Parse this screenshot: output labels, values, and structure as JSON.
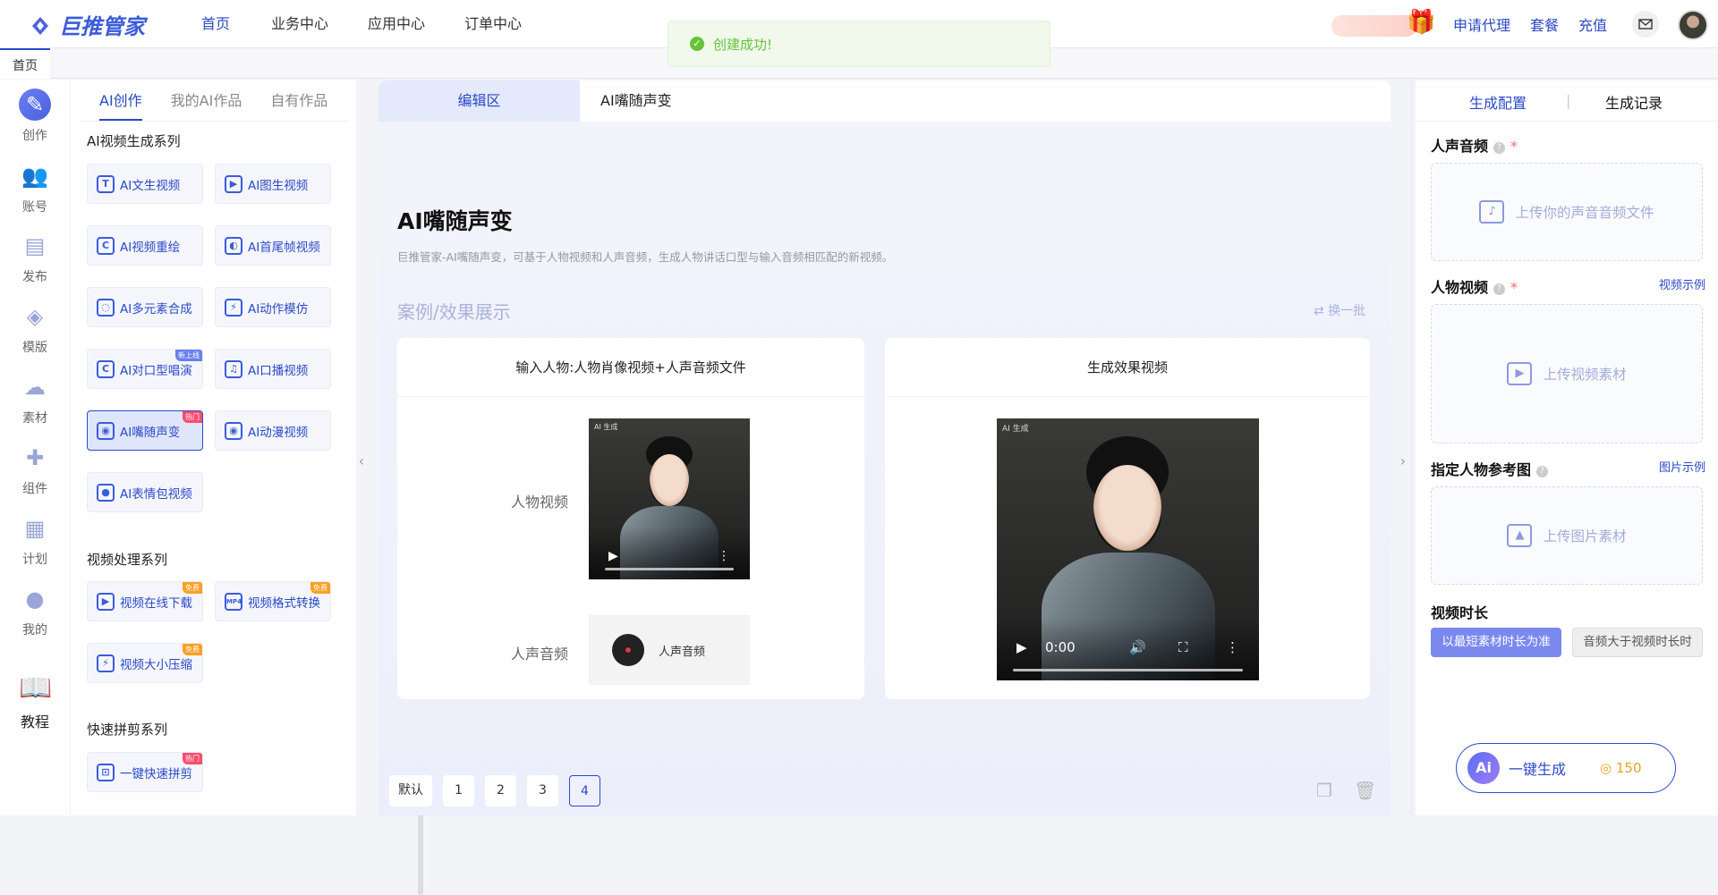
{
  "app": {
    "logo_text": "巨推管家"
  },
  "nav": [
    "首页",
    "业务中心",
    "应用中心",
    "订单中心"
  ],
  "toast": {
    "message": "创建成功!"
  },
  "top_links": [
    "申请代理",
    "套餐",
    "充值"
  ],
  "history_tab": "首页",
  "rail": [
    {
      "label": "创作",
      "icon": "pen-icon"
    },
    {
      "label": "账号",
      "icon": "users-icon"
    },
    {
      "label": "发布",
      "icon": "publish-icon"
    },
    {
      "label": "模版",
      "icon": "layers-icon"
    },
    {
      "label": "素材",
      "icon": "cloud-icon"
    },
    {
      "label": "组件",
      "icon": "puzzle-icon"
    },
    {
      "label": "计划",
      "icon": "calendar-icon"
    },
    {
      "label": "我的",
      "icon": "user-icon"
    },
    {
      "label": "教程",
      "icon": "book-icon"
    }
  ],
  "cat_tabs": [
    "AI创作",
    "我的AI作品",
    "自有作品"
  ],
  "series": [
    {
      "title": "AI视频生成系列",
      "tools": [
        "AI文生视频",
        "AI图生视频",
        "AI视频重绘",
        "AI首尾帧视频",
        "AI多元素合成",
        "AI动作模仿",
        "AI对口型唱演",
        "AI口播视频",
        "AI嘴随声变",
        "AI动漫视频",
        "AI表情包视频"
      ]
    },
    {
      "title": "视频处理系列",
      "tools": [
        "视频在线下载",
        "视频格式转换",
        "视频大小压缩"
      ]
    },
    {
      "title": "快速拼剪系列",
      "tools": [
        "一键快速拼剪"
      ]
    }
  ],
  "badges": {
    "new_online": "新上线",
    "hot": "热门",
    "free": "免费"
  },
  "center": {
    "tab_edit": "编辑区",
    "tab_feature": "AI嘴随声变",
    "title": "AI嘴随声变",
    "desc": "巨推管家-AI嘴随声变，可基于人物视频和人声音频，生成人物讲话口型与输入音频相匹配的新视频。",
    "case_title": "案例/效果展示",
    "swap": "换一批",
    "card_input_title": "输入人物:人物肖像视频+人声音频文件",
    "card_output_title": "生成效果视频",
    "label_video": "人物视频",
    "label_audio": "人声音频",
    "audio_name": "人声音频",
    "ai_tag": "AI 生成",
    "time": "0:00",
    "pager": [
      "默认",
      "1",
      "2",
      "3",
      "4"
    ],
    "active_page": "4"
  },
  "right": {
    "tab_config": "生成配置",
    "tab_records": "生成记录",
    "voice_label": "人声音频",
    "voice_upload": "上传你的声音音频文件",
    "video_label": "人物视频",
    "video_example": "视频示例",
    "video_upload": "上传视频素材",
    "ref_label": "指定人物参考图",
    "ref_example": "图片示例",
    "ref_upload": "上传图片素材",
    "duration_label": "视频时长",
    "duration_opt1": "以最短素材时长为准",
    "duration_opt2": "音频大于视频时长时",
    "generate": "一键生成",
    "coins": "150",
    "ai_badge": "Ai"
  },
  "colors": {
    "brand": "#2b49c9",
    "success": "#67c23a",
    "required": "#f56c6c"
  }
}
